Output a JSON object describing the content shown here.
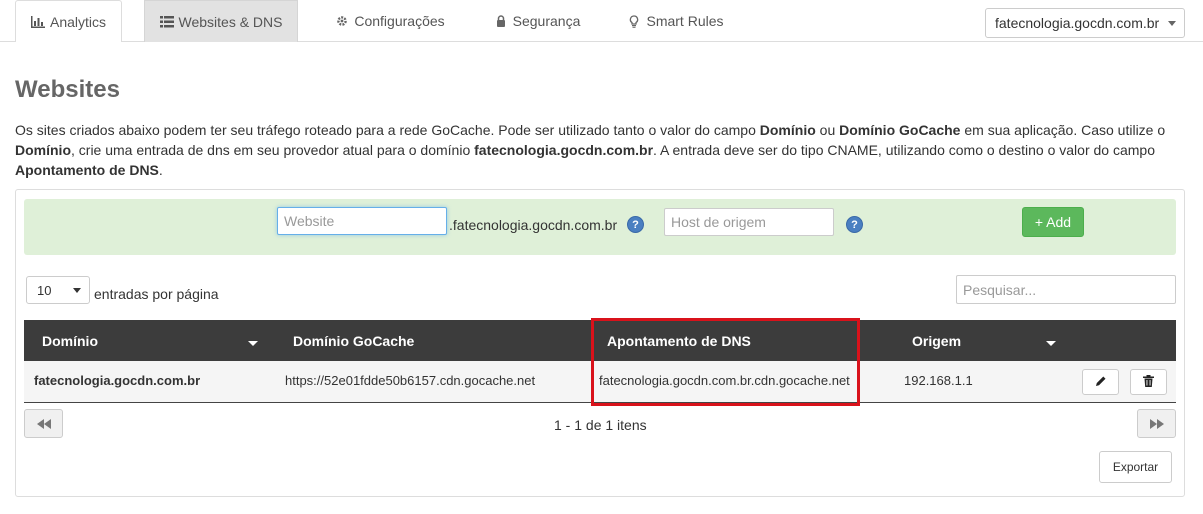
{
  "nav": {
    "tabs": [
      {
        "label": "Analytics",
        "icon": "bar-chart-icon"
      },
      {
        "label": "Websites & DNS",
        "icon": "list-icon"
      },
      {
        "label": "Configurações",
        "icon": "gear-icon"
      },
      {
        "label": "Segurança",
        "icon": "lock-icon"
      },
      {
        "label": "Smart Rules",
        "icon": "lightbulb-icon"
      }
    ],
    "active_tab": "Websites & DNS",
    "site_selector": "fatecnologia.gocdn.com.br"
  },
  "page": {
    "title": "Websites",
    "intro": {
      "p1": "Os sites criados abaixo podem ter seu tráfego roteado para a rede GoCache. Pode ser utilizado tanto o valor do campo ",
      "b1": "Domínio",
      "p2": " ou ",
      "b2": "Domínio GoCache",
      "p3": " em sua aplicação. Caso utilize o ",
      "b3": "Domínio",
      "p4": ", crie uma entrada de dns em seu provedor atual para o domínio ",
      "b4": "fatecnologia.gocdn.com.br",
      "p5": ". A entrada deve ser do tipo CNAME, utilizando como o destino o valor do campo ",
      "b5": "Apontamento de DNS",
      "p6": "."
    }
  },
  "add_form": {
    "website_placeholder": "Website",
    "suffix": ".fatecnologia.gocdn.com.br",
    "origin_placeholder": "Host de origem",
    "help_glyph": "?",
    "add_label": "+ Add"
  },
  "table_controls": {
    "per_page_value": "10",
    "per_page_label": "entradas por página",
    "search_placeholder": "Pesquisar..."
  },
  "table": {
    "headers": [
      "Domínio",
      "Domínio GoCache",
      "Apontamento de DNS",
      "Origem"
    ],
    "rows": [
      {
        "dominio": "fatecnologia.gocdn.com.br",
        "dominio_gocache": "https://52e01fdde50b6157.cdn.gocache.net",
        "apontamento": "fatecnologia.gocdn.com.br.cdn.gocache.net",
        "origem": "192.168.1.1"
      }
    ]
  },
  "pagination": {
    "info": "1 - 1 de 1 itens",
    "first_glyph": "◀◀",
    "last_glyph": "▶▶"
  },
  "export_label": "Exportar",
  "colors": {
    "highlight": "#d9121b",
    "add_bar": "#dff0d8",
    "add_button": "#5cb85c",
    "table_header": "#3c3c3c"
  }
}
